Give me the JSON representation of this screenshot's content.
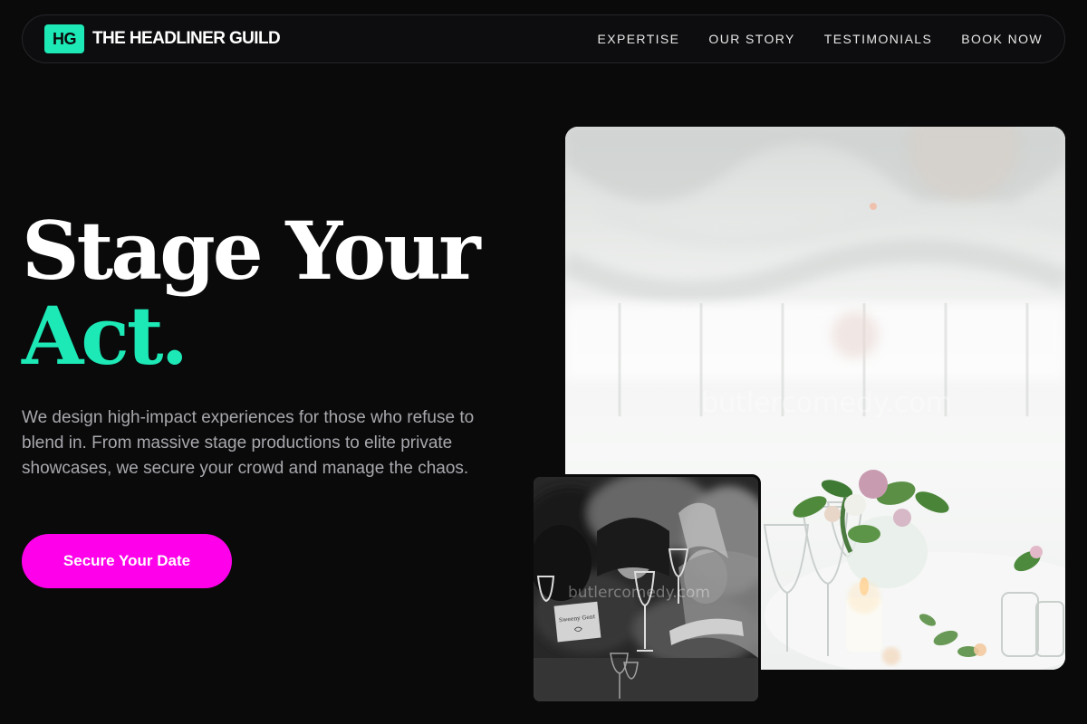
{
  "brand": {
    "badge": "HG",
    "name": "THE HEADLINER GUILD"
  },
  "nav": {
    "links": [
      "EXPERTISE",
      "OUR STORY",
      "TESTIMONIALS",
      "BOOK NOW"
    ]
  },
  "hero": {
    "title_line1": "Stage Your",
    "title_line2": "Act.",
    "description": "We design high-impact experiences for those who refuse to blend in. From massive stage productions to elite private showcases, we secure your crowd and manage the chaos.",
    "cta_label": "Secure Your Date"
  },
  "images": {
    "main_watermark": "butlercomedy.com",
    "small_watermark": "butlercomedy.com",
    "place_card_text": "Sweeny Gent"
  },
  "colors": {
    "background": "#0a0a0b",
    "accent_teal": "#1de9b6",
    "accent_magenta": "#ff00ea",
    "text_muted": "#a8a8ad"
  }
}
